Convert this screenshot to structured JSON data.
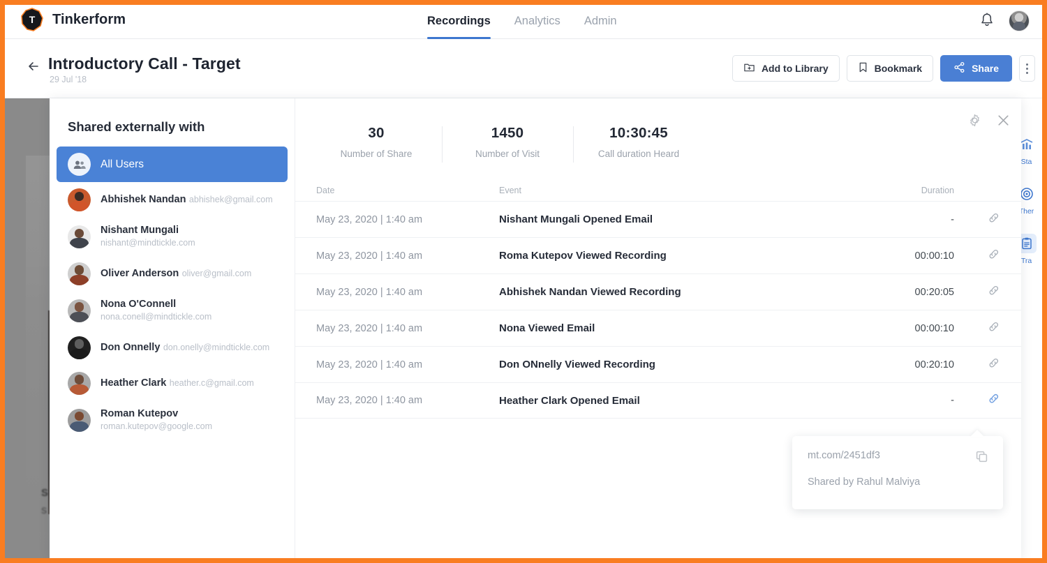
{
  "theme": {
    "frame_border": "#f97d21",
    "accent_blue": "#4a7fd4",
    "selected_blue": "#4a82d6",
    "text_dark": "#262c38",
    "text_muted": "#9aa2ad"
  },
  "topnav": {
    "brand": "Tinkerform",
    "logo_letter": "T",
    "tabs": [
      {
        "label": "Recordings",
        "active": true
      },
      {
        "label": "Analytics",
        "active": false
      },
      {
        "label": "Admin",
        "active": false
      }
    ],
    "bell_icon": "bell-icon",
    "avatar_icon": "user-avatar"
  },
  "subheader": {
    "back_icon": "back-arrow-icon",
    "title": "Introductory Call - Target",
    "date": "29 Jul '18",
    "actions": [
      {
        "label": "Add to Library",
        "icon": "add-to-folder-icon",
        "primary": false
      },
      {
        "label": "Bookmark",
        "icon": "bookmark-icon",
        "primary": false
      },
      {
        "label": "Share",
        "icon": "share-nodes-icon",
        "primary": true
      }
    ],
    "overflow_icon": "kebab-menu-icon"
  },
  "player": {
    "caption_line1": "S",
    "caption_line2": "S"
  },
  "right_rail": [
    {
      "label": "Sta",
      "icon": "stats-bar-chart-icon",
      "active": false
    },
    {
      "label": "Ther",
      "icon": "target-icon",
      "active": false
    },
    {
      "label": "Tra",
      "icon": "transcript-clipboard-icon",
      "active": true
    }
  ],
  "modal": {
    "sidebar": {
      "title": "Shared externally with",
      "items": [
        {
          "name": "All Users",
          "email": "",
          "selected": true,
          "icon": "all-users-icon"
        },
        {
          "name": "Abhishek Nandan",
          "email": "abhishek@gmail.com",
          "selected": false,
          "head": "#3a2b24",
          "body": "#d1552a",
          "bg": "#c95a2d"
        },
        {
          "name": "Nishant Mungali",
          "email": "nishant@mindtickle.com",
          "selected": false,
          "head": "#6a4a38",
          "body": "#3f434b",
          "bg": "#e8e8e8"
        },
        {
          "name": "Oliver Anderson",
          "email": "oliver@gmail.com",
          "selected": false,
          "head": "#6d4b36",
          "body": "#8d3f28",
          "bg": "#cfcfcf"
        },
        {
          "name": "Nona O'Connell",
          "email": "nona.conell@mindtickle.com",
          "selected": false,
          "head": "#7a5340",
          "body": "#4d4f56",
          "bg": "#b9b9b9"
        },
        {
          "name": "Don Onnelly",
          "email": "don.onelly@mindtickle.com",
          "selected": false,
          "head": "#5e5e5e",
          "body": "#1a1a1a",
          "bg": "#202020"
        },
        {
          "name": "Heather Clark",
          "email": "heather.c@gmail.com",
          "selected": false,
          "head": "#6e4d3b",
          "body": "#b75a36",
          "bg": "#a8a8a8"
        },
        {
          "name": "Roman Kutepov",
          "email": "roman.kutepov@google.com",
          "selected": false,
          "head": "#7a4a32",
          "body": "#4a5b74",
          "bg": "#9d9d9d"
        }
      ]
    },
    "tools": [
      {
        "icon": "settings-gear-icon",
        "name": "settings-button"
      },
      {
        "icon": "close-x-icon",
        "name": "close-button"
      }
    ],
    "stats": [
      {
        "value": "30",
        "label": "Number of Share"
      },
      {
        "value": "1450",
        "label": "Number of Visit"
      },
      {
        "value": "10:30:45",
        "label": "Call duration Heard"
      }
    ],
    "table": {
      "columns": [
        "Date",
        "Event",
        "Duration",
        ""
      ],
      "rows": [
        {
          "date": "May 23, 2020 | 1:40 am",
          "event": "Nishant Mungali Opened Email",
          "duration": "-",
          "link_active": false
        },
        {
          "date": "May 23, 2020 | 1:40 am",
          "event": "Roma Kutepov Viewed Recording",
          "duration": "00:00:10",
          "link_active": false
        },
        {
          "date": "May 23, 2020 | 1:40 am",
          "event": "Abhishek Nandan Viewed Recording",
          "duration": "00:20:05",
          "link_active": false
        },
        {
          "date": "May 23, 2020 | 1:40 am",
          "event": "Nona Viewed Email",
          "duration": "00:00:10",
          "link_active": false
        },
        {
          "date": "May 23, 2020 | 1:40 am",
          "event": "Don ONnelly Viewed Recording",
          "duration": "00:20:10",
          "link_active": false
        },
        {
          "date": "May 23, 2020 | 1:40 am",
          "event": "Heather Clark Opened Email",
          "duration": "-",
          "link_active": true
        }
      ]
    },
    "popover": {
      "url": "mt.com/2451df3",
      "shared_by": "Shared by Rahul Malviya",
      "copy_icon": "copy-icon"
    }
  }
}
